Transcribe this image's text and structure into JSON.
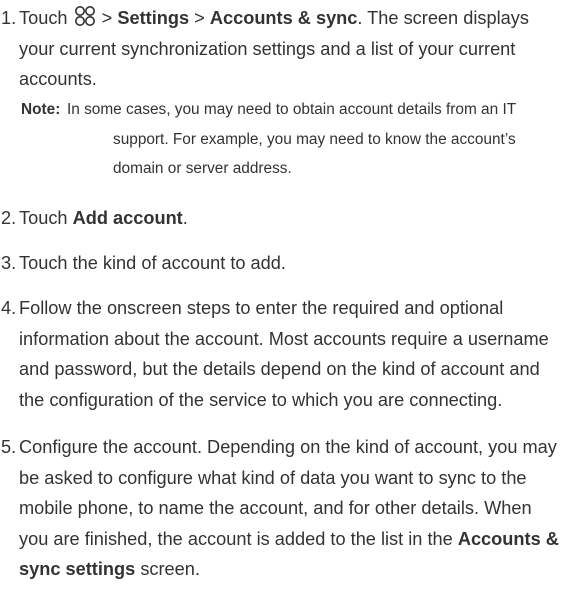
{
  "steps": [
    {
      "num": "1.",
      "parts": {
        "touch": "Touch",
        "sep1": ">",
        "settings": "Settings",
        "sep2": ">",
        "accounts_sync": "Accounts & sync",
        "rest": ". The screen displays your current synchronization settings and a list of your current accounts."
      },
      "icon": "apps-grid-icon"
    },
    {
      "num": "2.",
      "parts": {
        "touch": "Touch",
        "add_account": "Add account",
        "end": "."
      }
    },
    {
      "num": "3.",
      "text": "Touch the kind of account to add."
    },
    {
      "num": "4.",
      "text": "Follow the onscreen steps to enter the required and optional information about the account. Most accounts require a username and password, but the details depend on the kind of account and the configuration of the service to which you are connecting."
    },
    {
      "num": "5.",
      "parts": {
        "text": "Configure the account. Depending on the kind of account, you may be asked to configure what kind of data you want to sync to the mobile phone, to name the account, and for other details. When you are finished, the account is added to the list in the",
        "accounts_sync_settings": "Accounts & sync settings",
        "end": "screen."
      }
    }
  ],
  "note": {
    "label": "Note:",
    "text": "In some cases, you may need to obtain account details from an IT support. For example, you may need to know the account’s domain or server address."
  }
}
